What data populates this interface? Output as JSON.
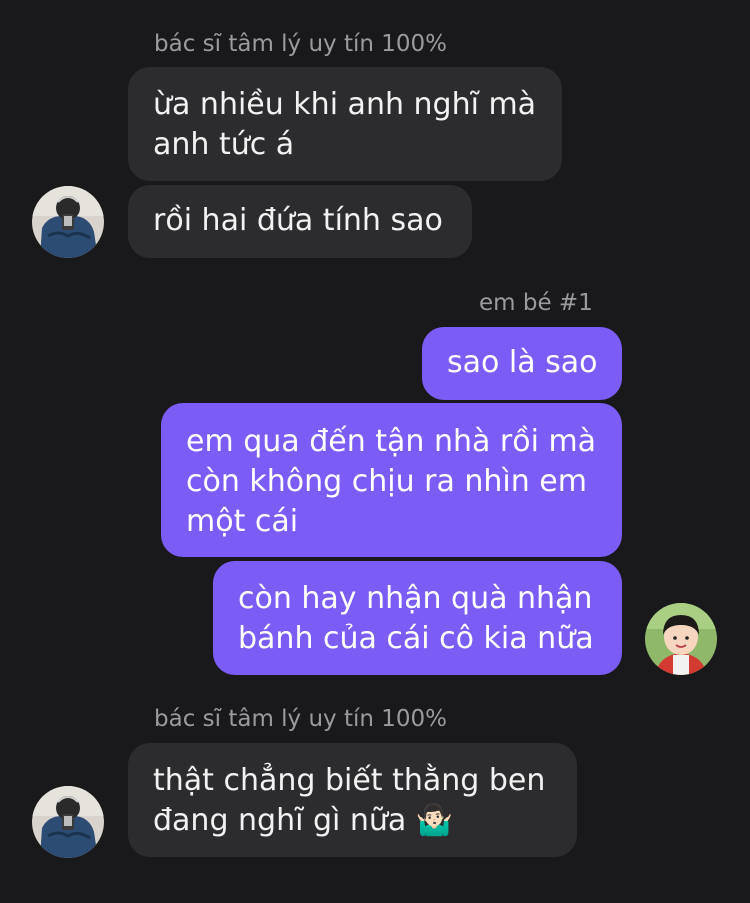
{
  "thread": {
    "group1": {
      "sender_name": "bác sĩ tâm lý uy tín 100%",
      "messages": [
        "ừa nhiều khi anh nghĩ mà\nanh tức á",
        "rồi hai đứa tính sao"
      ],
      "avatar_icon": "user-photo-icon"
    },
    "group2": {
      "sender_name": "em bé #1",
      "messages": [
        "sao là sao",
        "em qua đến tận nhà rồi mà\ncòn không chịu ra nhìn em\nmột cái",
        "còn hay nhận quà nhận\nbánh của cái cô kia nữa"
      ],
      "avatar_icon": "child-photo-icon"
    },
    "group3": {
      "sender_name": "bác sĩ tâm lý uy tín 100%",
      "messages": [
        "thật chẳng biết thằng ben\nđang nghĩ gì nữa 🤷🏻‍♂️"
      ],
      "avatar_icon": "user-photo-icon"
    }
  },
  "colors": {
    "background": "#19191b",
    "incoming_bubble": "#2c2c2f",
    "outgoing_bubble": "#7b5cf5",
    "sender_name": "#9a9aa0"
  }
}
